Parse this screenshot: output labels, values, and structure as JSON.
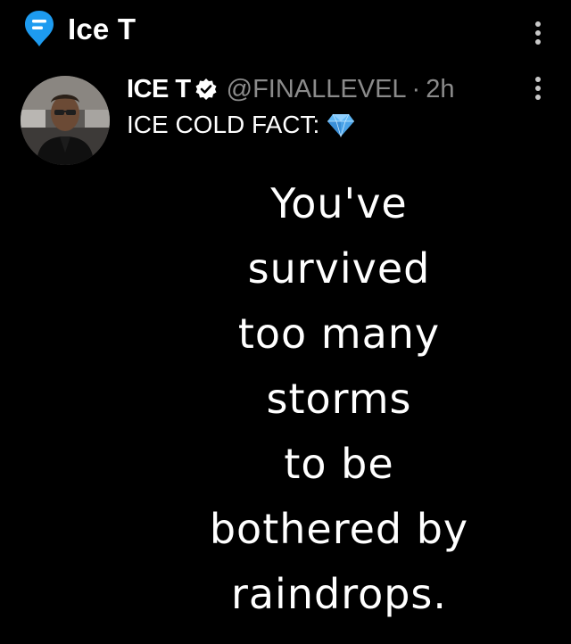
{
  "top_bar": {
    "title": "Ice T"
  },
  "tweet": {
    "author_name": "ICE T",
    "handle": "@FINALLEVEL",
    "separator": "·",
    "time": "2h",
    "text": "ICE COLD FACT:",
    "emoji": "gem-stone"
  },
  "quote": {
    "lines": [
      "You've",
      "survived",
      "too many",
      "storms",
      "to be",
      "bothered by",
      "raindrops."
    ]
  },
  "colors": {
    "background": "#000000",
    "text": "#ffffff",
    "secondary_text": "#8b8b8b",
    "chat_icon": "#1d9bf0",
    "verified_badge": "#ffffff",
    "gem": "#5fb7f5"
  }
}
